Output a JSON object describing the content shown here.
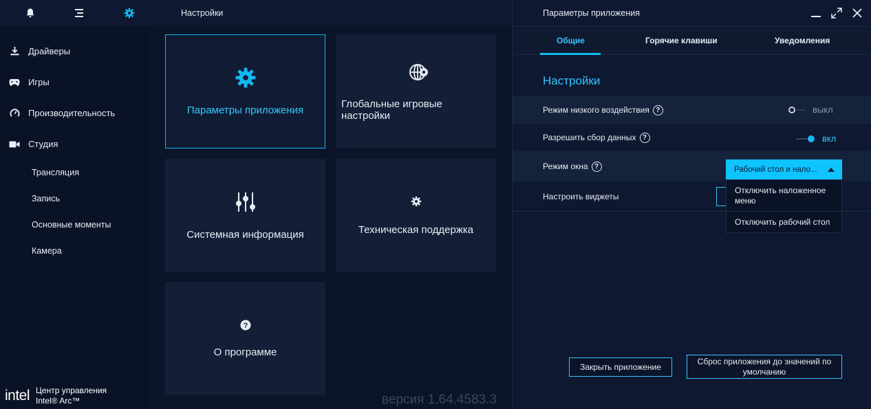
{
  "sidebar": {
    "nav": [
      {
        "label": "Драйверы",
        "icon": "download-icon"
      },
      {
        "label": "Игры",
        "icon": "gamepad-icon"
      },
      {
        "label": "Производительность",
        "icon": "gauge-icon"
      },
      {
        "label": "Студия",
        "icon": "video-camera-icon"
      }
    ],
    "sub": [
      "Трансляция",
      "Запись",
      "Основные моменты",
      "Камера"
    ],
    "brand_logo": "intel",
    "brand_line1": "Центр управления",
    "brand_line2": "Intel® Arc™"
  },
  "middle": {
    "header": "Настройки",
    "tiles": [
      {
        "label": "Параметры приложения",
        "icon": "gear-icon",
        "active": true
      },
      {
        "label": "Глобальные игровые настройки",
        "icon": "globe-gear-icon",
        "active": false
      },
      {
        "label": "Системная информация",
        "icon": "sliders-icon",
        "active": false
      },
      {
        "label": "Техническая поддержка",
        "icon": "small-gear-icon",
        "active": false
      },
      {
        "label": "О программе",
        "icon": "help-circle-icon",
        "active": false
      }
    ],
    "version": "версия 1.64.4583.3"
  },
  "right": {
    "title": "Параметры приложения",
    "tabs": [
      "Общие",
      "Горячие клавиши",
      "Уведомления"
    ],
    "active_tab": "Общие",
    "section_title": "Настройки",
    "rows": {
      "low_impact": {
        "label": "Режим низкого воздействия",
        "state": "выкл"
      },
      "data_collection": {
        "label": "Разрешить сбор данных",
        "state": "вкл"
      },
      "window_mode": {
        "label": "Режим окна",
        "value": "Рабочий стол и нало..."
      },
      "widgets": {
        "label": "Настроить виджеты"
      }
    },
    "dropdown_options": [
      "Отключить наложенное меню",
      "Отключить рабочий стол"
    ],
    "buttons": {
      "close_app": "Закрыть приложение",
      "reset": "Сброс приложения до значений по умолчанию"
    }
  },
  "colors": {
    "accent": "#14b8f0",
    "accent_text": "#35c8ff",
    "panel": "#131f37",
    "background": "#0b1428"
  }
}
